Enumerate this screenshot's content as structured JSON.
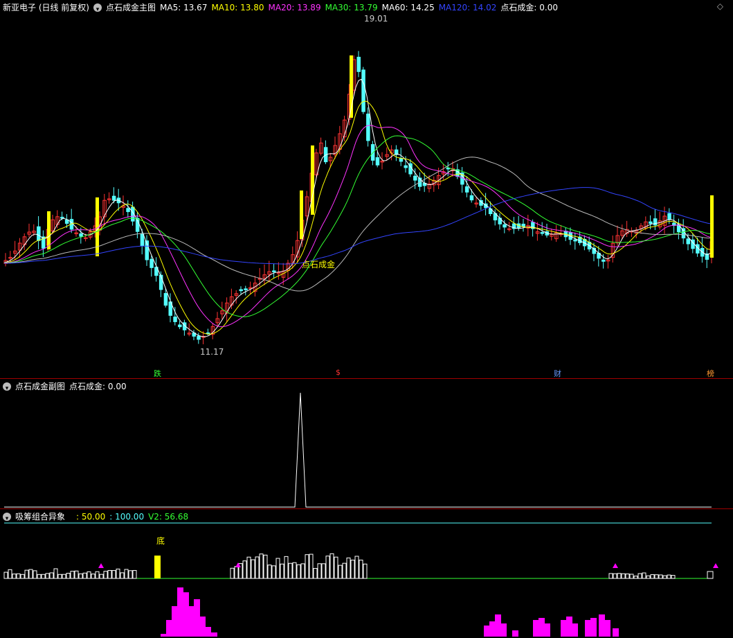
{
  "main": {
    "title": "新亚电子 (日线 前复权)",
    "indicator": "点石成金主图",
    "ma": [
      {
        "label": "MA5:",
        "value": "13.67",
        "color": "#ffffff"
      },
      {
        "label": "MA10:",
        "value": "13.80",
        "color": "#ffff00"
      },
      {
        "label": "MA20:",
        "value": "13.89",
        "color": "#ff33ff"
      },
      {
        "label": "MA30:",
        "value": "13.79",
        "color": "#33ff33"
      },
      {
        "label": "MA60:",
        "value": "14.25",
        "color": "#ffffff"
      },
      {
        "label": "MA120:",
        "value": "14.02",
        "color": "#3344ff"
      },
      {
        "label": "点石成金:",
        "value": "0.00",
        "color": "#ffffff"
      }
    ],
    "high_label": "19.01",
    "low_label": "11.17",
    "signal_label": "点石成金",
    "marks": [
      "跌",
      "$",
      "财",
      "榜"
    ]
  },
  "sub": {
    "title": "点石成金副图",
    "value_label": "点石成金:",
    "value": "0.00"
  },
  "abs": {
    "title": "吸筹组合异象",
    "v1": ": 50.00",
    "v2": ": 100.00",
    "v3": "V2: 56.68",
    "bottom_label": "底"
  },
  "colors": {
    "up": "#ff3333",
    "down": "#54ffff",
    "yellow": "#ffff00",
    "magenta": "#ff00ff",
    "border": "#a00000"
  }
}
